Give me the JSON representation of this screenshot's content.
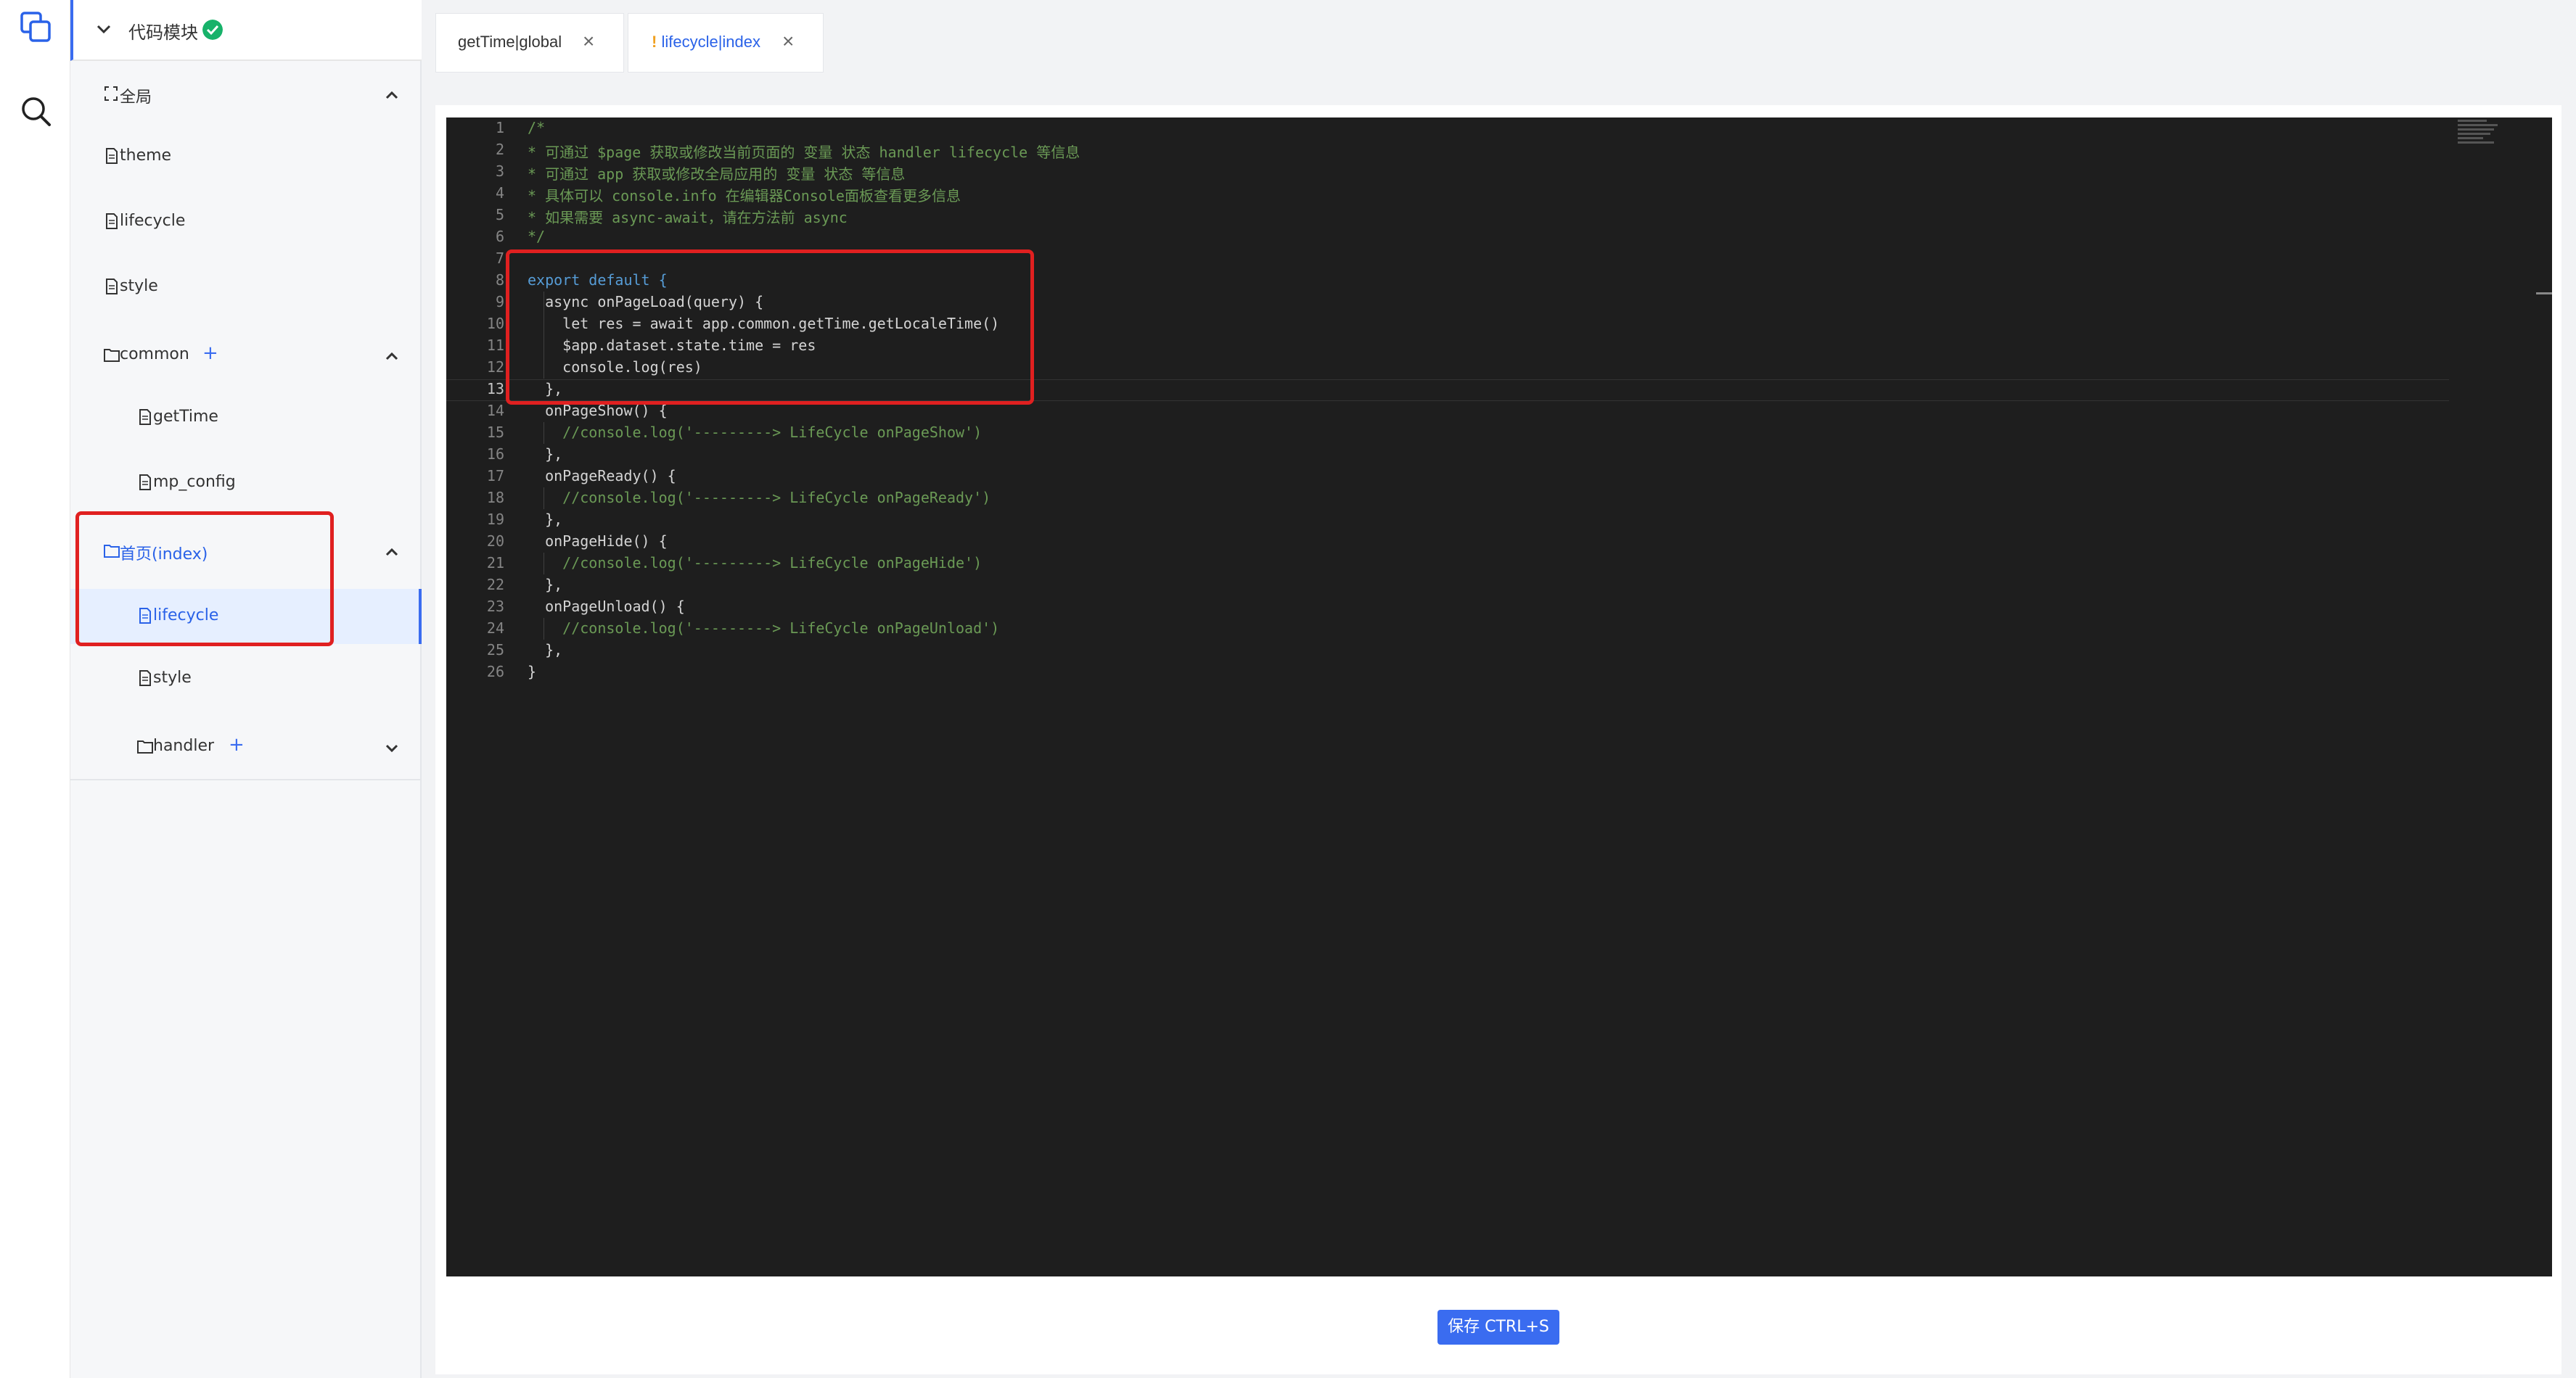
{
  "rail": {
    "icons": [
      "copy-icon",
      "search-icon"
    ]
  },
  "tree": {
    "title": "代码模块",
    "nodes": {
      "global": "全局",
      "theme": "theme",
      "lifecycle": "lifecycle",
      "style": "style",
      "common": "common",
      "getTime": "getTime",
      "mp_config": "mp_config",
      "index": "首页(index)",
      "index_lifecycle": "lifecycle",
      "index_style": "style",
      "handler": "handler"
    },
    "plus": "+"
  },
  "tabs": [
    {
      "label": "getTime|global",
      "close": "×"
    },
    {
      "prefix": "!",
      "label": "lifecycle|index",
      "close": "×"
    }
  ],
  "editor": {
    "line_numbers": [
      "1",
      "2",
      "3",
      "4",
      "5",
      "6",
      "7",
      "8",
      "9",
      "10",
      "11",
      "12",
      "13",
      "14",
      "15",
      "16",
      "17",
      "18",
      "19",
      "20",
      "21",
      "22",
      "23",
      "24",
      "25",
      "26"
    ],
    "current_line": "13",
    "lines": [
      "/*",
      "* 可通过 $page 获取或修改当前页面的 变量 状态 handler lifecycle 等信息",
      "* 可通过 app 获取或修改全局应用的 变量 状态 等信息",
      "* 具体可以 console.info 在编辑器Console面板查看更多信息",
      "* 如果需要 async-await，请在方法前 async",
      "*/",
      "",
      "export default {",
      "  async onPageLoad(query) {",
      "    let res = await app.common.getTime.getLocaleTime()",
      "    $app.dataset.state.time = res",
      "    console.log(res)",
      "  },",
      "  onPageShow() {",
      "    //console.log('---------> LifeCycle onPageShow')",
      "  },",
      "  onPageReady() {",
      "    //console.log('---------> LifeCycle onPageReady')",
      "  },",
      "  onPageHide() {",
      "    //console.log('---------> LifeCycle onPageHide')",
      "  },",
      "  onPageUnload() {",
      "    //console.log('---------> LifeCycle onPageUnload')",
      "  },",
      "}"
    ]
  },
  "save_label": "保存 CTRL+S",
  "colors": {
    "accent": "#3a6cf0",
    "annotation": "#e02020",
    "editor_bg": "#1e1e1e",
    "comment": "#6a9955",
    "keyword": "#569cd6"
  }
}
